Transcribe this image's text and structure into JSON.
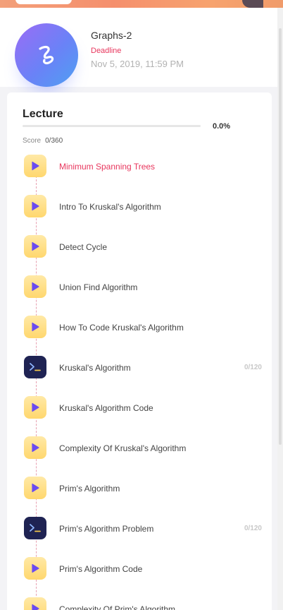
{
  "course": {
    "title": "Graphs-2",
    "deadline_label": "Deadline",
    "deadline_date": "Nov 5, 2019, 11:59 PM"
  },
  "lecture": {
    "title": "Lecture",
    "progress_text": "0.0%",
    "progress_value": 0,
    "score_label": "Score",
    "score_value": "0/360"
  },
  "colors": {
    "accent": "#e8365d",
    "video_icon_bg": "#ffd76e",
    "code_icon_bg": "#1f2353",
    "play": "#6a4bf0"
  },
  "items": [
    {
      "label": "Minimum Spanning Trees",
      "type": "video",
      "icon": "play-icon",
      "active": true,
      "score": ""
    },
    {
      "label": "Intro To Kruskal's Algorithm",
      "type": "video",
      "icon": "play-icon",
      "active": false,
      "score": ""
    },
    {
      "label": "Detect Cycle",
      "type": "video",
      "icon": "play-icon",
      "active": false,
      "score": ""
    },
    {
      "label": "Union Find Algorithm",
      "type": "video",
      "icon": "play-icon",
      "active": false,
      "score": ""
    },
    {
      "label": "How To Code Kruskal's Algorithm",
      "type": "video",
      "icon": "play-icon",
      "active": false,
      "score": ""
    },
    {
      "label": "Kruskal's Algorithm",
      "type": "code",
      "icon": "terminal-icon",
      "active": false,
      "score": "0/120"
    },
    {
      "label": "Kruskal's Algorithm Code",
      "type": "video",
      "icon": "play-icon",
      "active": false,
      "score": ""
    },
    {
      "label": "Complexity Of Kruskal's Algorithm",
      "type": "video",
      "icon": "play-icon",
      "active": false,
      "score": ""
    },
    {
      "label": "Prim's Algorithm",
      "type": "video",
      "icon": "play-icon",
      "active": false,
      "score": ""
    },
    {
      "label": "Prim's Algorithm Problem",
      "type": "code",
      "icon": "terminal-icon",
      "active": false,
      "score": "0/120"
    },
    {
      "label": "Prim's Algorithm Code",
      "type": "video",
      "icon": "play-icon",
      "active": false,
      "score": ""
    },
    {
      "label": "Complexity Of Prim's Algorithm",
      "type": "video",
      "icon": "play-icon",
      "active": false,
      "score": ""
    }
  ]
}
